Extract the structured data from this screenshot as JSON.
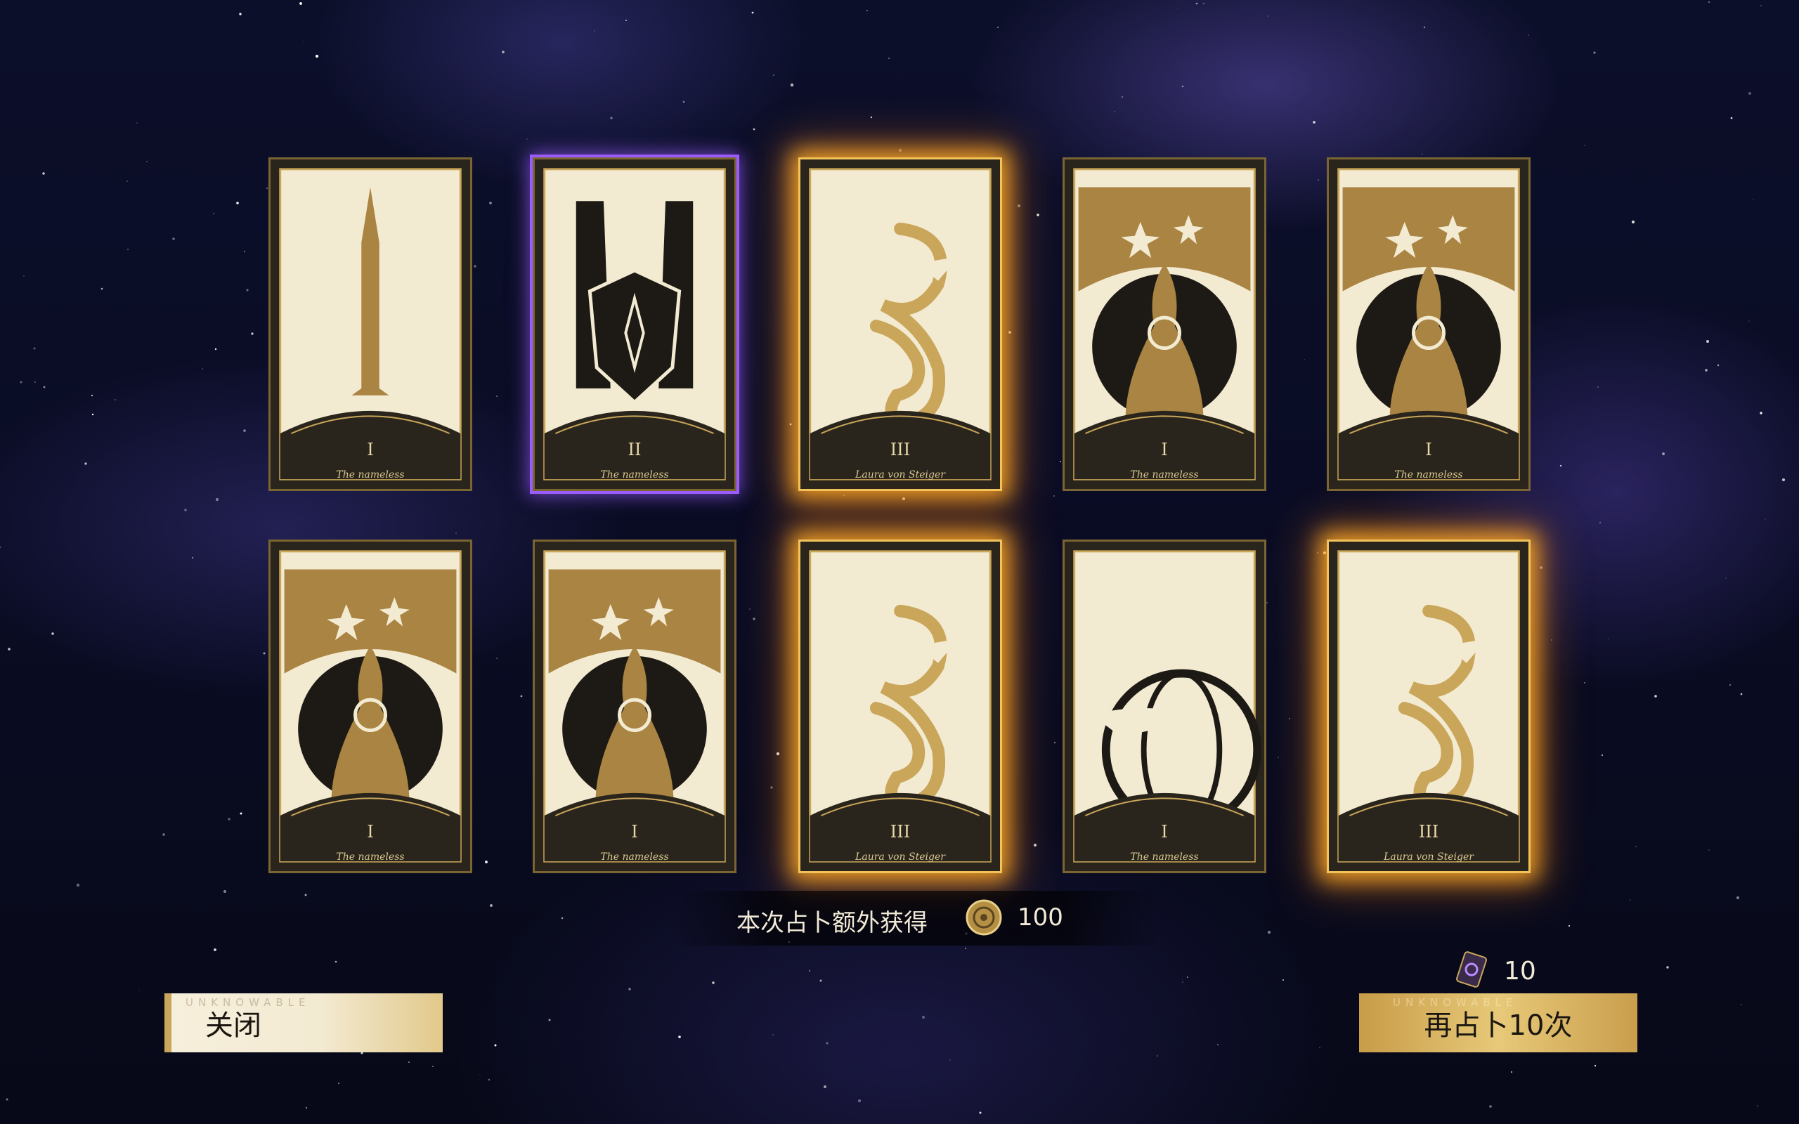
{
  "cards": [
    {
      "numeral": "I",
      "name": "The nameless",
      "art": "sword",
      "state": "normal"
    },
    {
      "numeral": "II",
      "name": "The nameless",
      "art": "shield",
      "state": "selected"
    },
    {
      "numeral": "III",
      "name": "Laura von Steiger",
      "art": "dragon",
      "state": "glow"
    },
    {
      "numeral": "I",
      "name": "The nameless",
      "art": "goddess",
      "state": "normal"
    },
    {
      "numeral": "I",
      "name": "The nameless",
      "art": "goddess",
      "state": "normal"
    },
    {
      "numeral": "I",
      "name": "The nameless",
      "art": "goddess",
      "state": "normal"
    },
    {
      "numeral": "I",
      "name": "The nameless",
      "art": "goddess",
      "state": "normal"
    },
    {
      "numeral": "III",
      "name": "Laura von Steiger",
      "art": "dragon",
      "state": "glow"
    },
    {
      "numeral": "I",
      "name": "The nameless",
      "art": "globe",
      "state": "normal"
    },
    {
      "numeral": "III",
      "name": "Laura von Steiger",
      "art": "dragon",
      "state": "glow"
    }
  ],
  "bonus": {
    "label": "本次占卜额外获得",
    "icon": "gold-coin-icon",
    "value": "100"
  },
  "buttons": {
    "close_label": "关闭",
    "retry_label": "再占卜10次",
    "watermark": "UNKNOWABLE"
  },
  "cost": {
    "icon": "divination-ticket-icon",
    "value": "10"
  },
  "colors": {
    "gold": "#c9a65a",
    "selected": "#9b5cff",
    "glow": "#ffaa28",
    "background": "#0a0c24"
  }
}
